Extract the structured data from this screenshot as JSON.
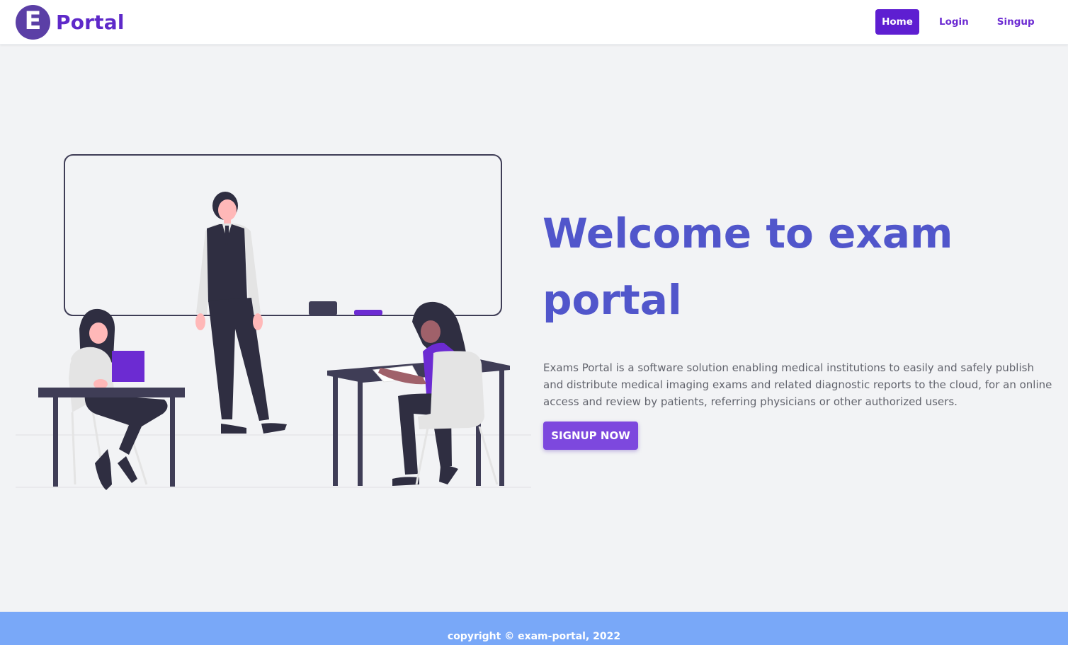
{
  "navbar": {
    "logo_letter": "E",
    "brand_name": "Portal",
    "links": [
      {
        "label": "Home",
        "active": true
      },
      {
        "label": "Login",
        "active": false
      },
      {
        "label": "Singup",
        "active": false
      }
    ]
  },
  "hero": {
    "title": "Welcome to exam portal",
    "description": "Exams Portal is a software solution enabling medical institutions to easily and safely publish and distribute medical imaging exams and related diagnostic reports to the cloud, for an online access and review by patients, referring physicians or other authorized users.",
    "cta_label": "SIGNUP NOW",
    "illustration_icon": "classroom-illustration"
  },
  "footer": {
    "copyright": "copyright © exam-portal, 2022"
  },
  "colors": {
    "brand": "#5e29c9",
    "nav_active_bg": "#5e1ed1",
    "title": "#5156cb",
    "cta_bg": "#7d48de",
    "footer_bg": "#79a8f8",
    "page_bg": "#f2f3f5"
  }
}
